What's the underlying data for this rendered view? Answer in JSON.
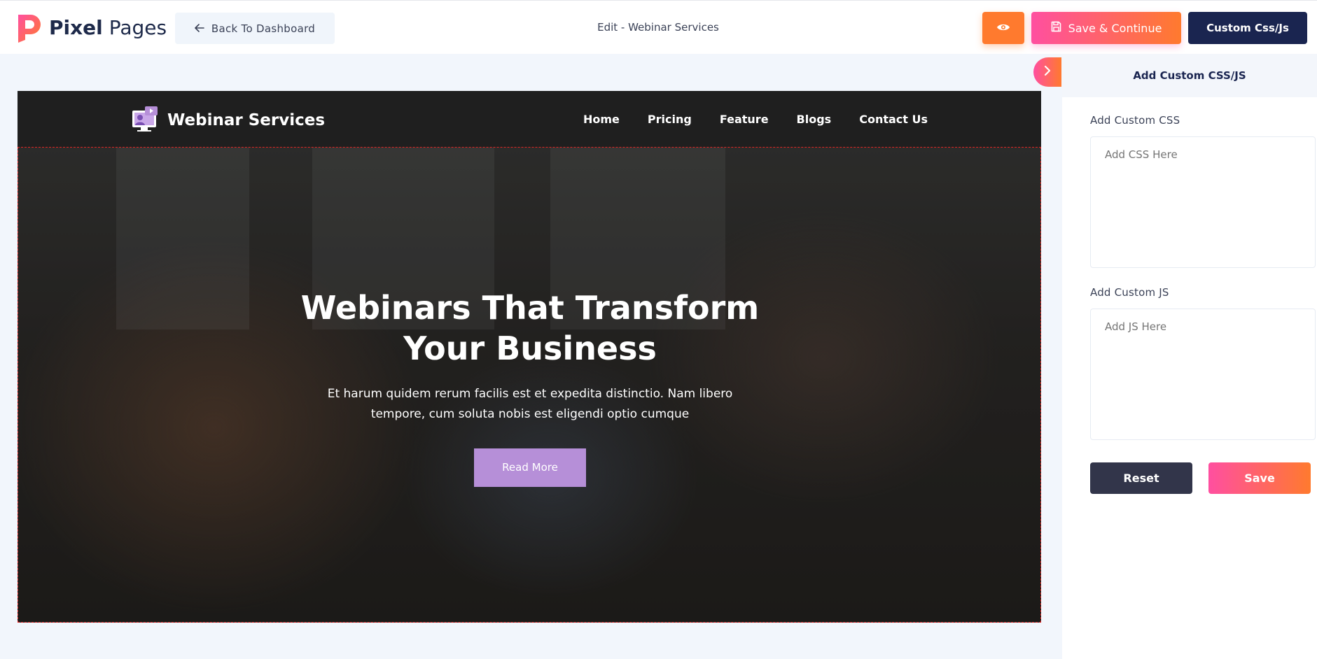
{
  "app": {
    "brand_bold": "Pixel",
    "brand_light": "Pages",
    "back_label": "Back To Dashboard",
    "edit_title": "Edit - Webinar Services",
    "save_continue_label": "Save & Continue",
    "custom_label": "Custom Css/Js"
  },
  "site": {
    "brand": "Webinar Services",
    "menu": [
      "Home",
      "Pricing",
      "Feature",
      "Blogs",
      "Contact Us"
    ],
    "hero": {
      "title": "Webinars That Transform Your Business",
      "subtitle": "Et harum quidem rerum facilis est et expedita distinctio. Nam libero tempore, cum soluta nobis est eligendi optio cumque",
      "button": "Read More"
    }
  },
  "panel": {
    "title": "Add Custom CSS/JS",
    "css_label": "Add Custom CSS",
    "css_placeholder": "Add CSS Here",
    "js_label": "Add Custom JS",
    "js_placeholder": "Add JS Here",
    "reset_label": "Reset",
    "save_label": "Save"
  },
  "colors": {
    "accent_orange": "#ff7a2e",
    "accent_pink": "#ff4fa0",
    "navy": "#1a2550",
    "hero_button": "#b68fd8"
  },
  "icons": {
    "logo": "pixel-pages-logo-icon",
    "back": "arrow-left-icon",
    "preview": "eye-icon",
    "save": "floppy-disk-icon",
    "toggle": "chevron-right-icon",
    "site_logo": "webinar-monitor-icon"
  }
}
